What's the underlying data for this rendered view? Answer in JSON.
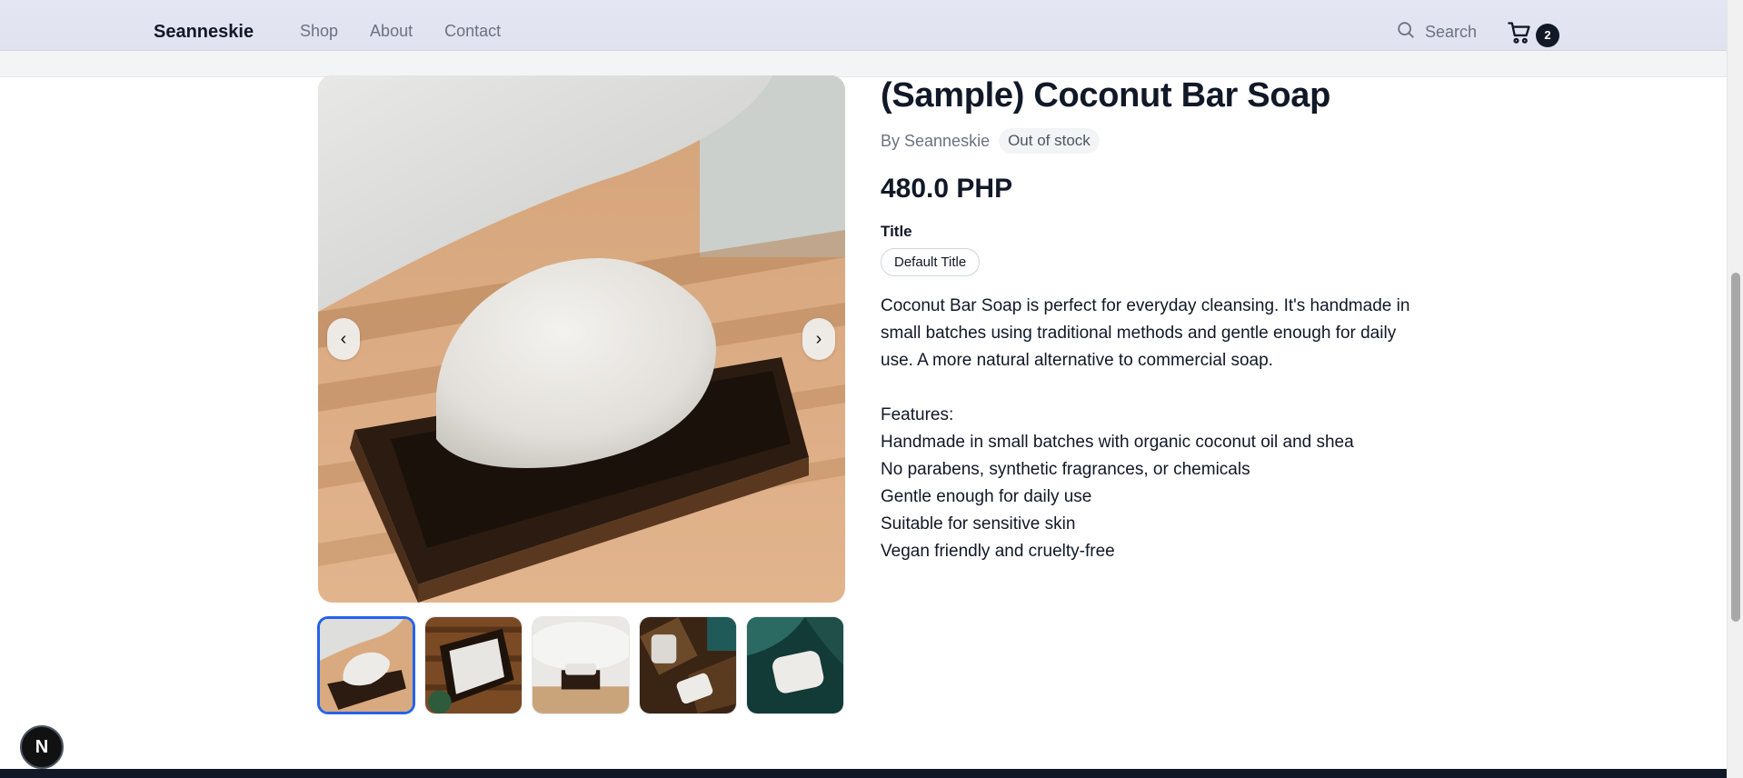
{
  "header": {
    "brand": "Seanneskie",
    "nav": [
      {
        "label": "Shop"
      },
      {
        "label": "About"
      },
      {
        "label": "Contact"
      }
    ],
    "search_label": "Search",
    "cart_count": "2"
  },
  "product": {
    "title": "(Sample) Coconut Bar Soap",
    "by": "By Seanneskie",
    "status": "Out of stock",
    "price": "480.0 PHP",
    "option_label": "Title",
    "option_value": "Default Title",
    "description": "Coconut Bar Soap is perfect for everyday cleansing. It's handmade in small batches using traditional methods and gentle enough for daily use. A more natural alternative to commercial soap.",
    "features_heading": "Features:",
    "features": [
      "Handmade in small batches with organic coconut oil and shea",
      "No parabens, synthetic fragrances, or chemicals",
      "Gentle enough for daily use",
      "Suitable for sensitive skin",
      "Vegan friendly and cruelty-free"
    ]
  },
  "gallery": {
    "prev_label": "‹",
    "next_label": "›",
    "thumb_count": 5,
    "active_index": 0
  },
  "floating": {
    "badge_letter": "N"
  },
  "colors": {
    "accent": "#2563eb",
    "header_bg": "#e2e4f1",
    "badge_bg": "#111827"
  }
}
